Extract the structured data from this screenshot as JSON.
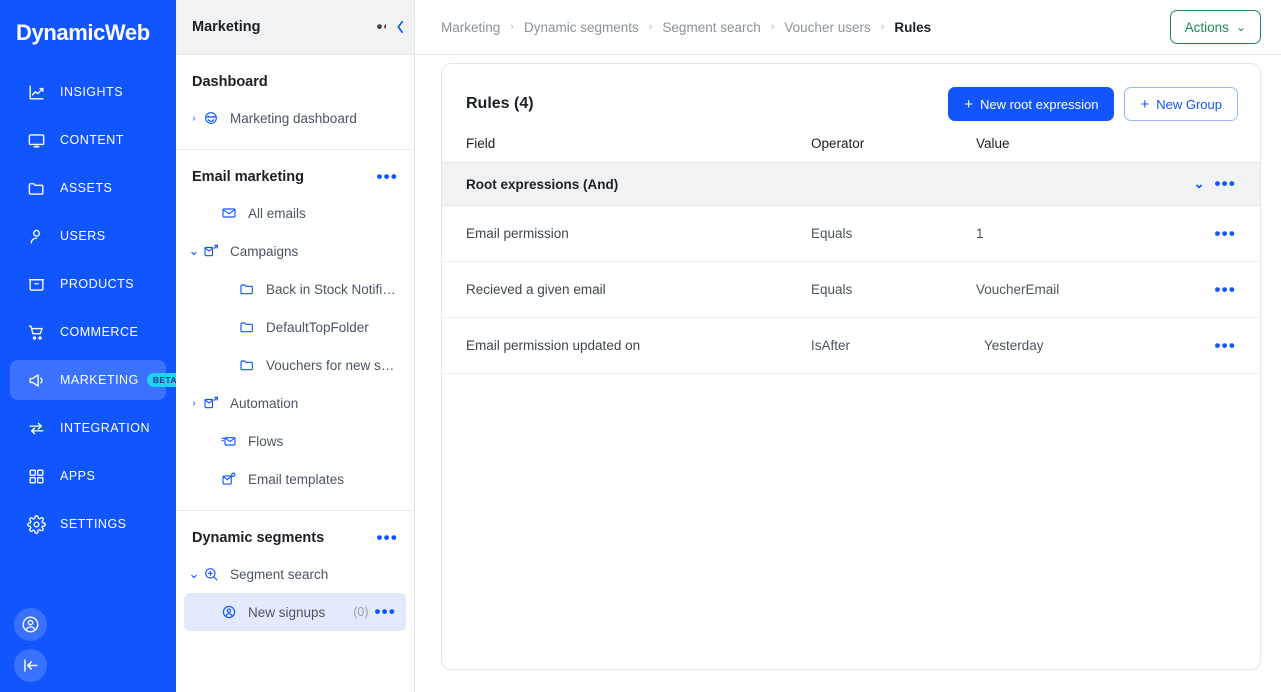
{
  "brand": {
    "name": "DynamicWeb",
    "accent": "#1155ff"
  },
  "leftnav": {
    "items": [
      {
        "label": "INSIGHTS",
        "icon": "chart-line-icon",
        "active": false
      },
      {
        "label": "CONTENT",
        "icon": "monitor-icon",
        "active": false
      },
      {
        "label": "ASSETS",
        "icon": "folder-icon",
        "active": false
      },
      {
        "label": "USERS",
        "icon": "user-icon",
        "active": false
      },
      {
        "label": "PRODUCTS",
        "icon": "box-icon",
        "active": false
      },
      {
        "label": "COMMERCE",
        "icon": "cart-icon",
        "active": false
      },
      {
        "label": "MARKETING",
        "icon": "megaphone-icon",
        "active": true,
        "badge": "BETA"
      },
      {
        "label": "INTEGRATION",
        "icon": "exchange-arrows-icon",
        "active": false
      },
      {
        "label": "APPS",
        "icon": "grid-squares-icon",
        "active": false
      },
      {
        "label": "SETTINGS",
        "icon": "gear-icon",
        "active": false
      }
    ],
    "bottom": [
      {
        "icon": "account-circle-icon",
        "name": "account-button"
      },
      {
        "icon": "collapse-left-icon",
        "name": "collapse-nav-button"
      }
    ]
  },
  "tree": {
    "header": {
      "title": "Marketing",
      "menu": "•••",
      "collapse": "‹"
    },
    "sections": [
      {
        "title": "Dashboard",
        "menu": null,
        "items": [
          {
            "label": "Marketing dashboard",
            "icon": "dashboard-globe-icon",
            "caret": "›",
            "indent": 0
          }
        ]
      },
      {
        "title": "Email marketing",
        "menu": "•••",
        "items": [
          {
            "label": "All emails",
            "icon": "envelope-icon",
            "caret": "",
            "indent": 1
          },
          {
            "label": "Campaigns",
            "icon": "campaign-icon",
            "caret": "⌄",
            "indent": 0
          },
          {
            "label": "Back in Stock Notification",
            "icon": "folder-outline-icon",
            "caret": "",
            "indent": 2
          },
          {
            "label": "DefaultTopFolder",
            "icon": "folder-outline-icon",
            "caret": "",
            "indent": 2
          },
          {
            "label": "Vouchers for new signups",
            "icon": "folder-outline-icon",
            "caret": "",
            "indent": 2
          },
          {
            "label": "Automation",
            "icon": "automation-icon",
            "caret": "›",
            "indent": 0
          },
          {
            "label": "Flows",
            "icon": "flows-icon",
            "caret": "",
            "indent": 1
          },
          {
            "label": "Email templates",
            "icon": "email-template-icon",
            "caret": "",
            "indent": 1
          }
        ]
      },
      {
        "title": "Dynamic segments",
        "menu": "•••",
        "items": [
          {
            "label": "Segment search",
            "icon": "search-plus-icon",
            "caret": "⌄",
            "indent": 0
          },
          {
            "label": "New signups",
            "icon": "segment-user-icon",
            "caret": "",
            "indent": 1,
            "count": "(0)",
            "menu": "•••",
            "selected": true
          }
        ]
      }
    ]
  },
  "topbar": {
    "breadcrumb": [
      {
        "label": "Marketing",
        "current": false
      },
      {
        "label": "Dynamic segments",
        "current": false
      },
      {
        "label": "Segment search",
        "current": false
      },
      {
        "label": "Voucher users",
        "current": false
      },
      {
        "label": "Rules",
        "current": true
      }
    ],
    "separator": "›",
    "actions_button": {
      "label": "Actions",
      "caret": "⌄",
      "color": "#1e8a52"
    }
  },
  "rules_card": {
    "title": "Rules (4)",
    "buttons": {
      "new_root_expression": "New root expression",
      "new_group": "New Group",
      "plus": "+"
    },
    "columns": {
      "field": "Field",
      "operator": "Operator",
      "value": "Value"
    },
    "group": {
      "label": "Root expressions (And)",
      "chevron": "⌄",
      "menu": "•••"
    },
    "rows": [
      {
        "field": "Email permission",
        "operator": "Equals",
        "value": "1",
        "menu": "•••",
        "value_indent": false
      },
      {
        "field": "Recieved a given email",
        "operator": "Equals",
        "value": "VoucherEmail",
        "menu": "•••",
        "value_indent": false
      },
      {
        "field": "Email permission updated on",
        "operator": "IsAfter",
        "value": "Yesterday",
        "menu": "•••",
        "value_indent": true
      }
    ]
  }
}
